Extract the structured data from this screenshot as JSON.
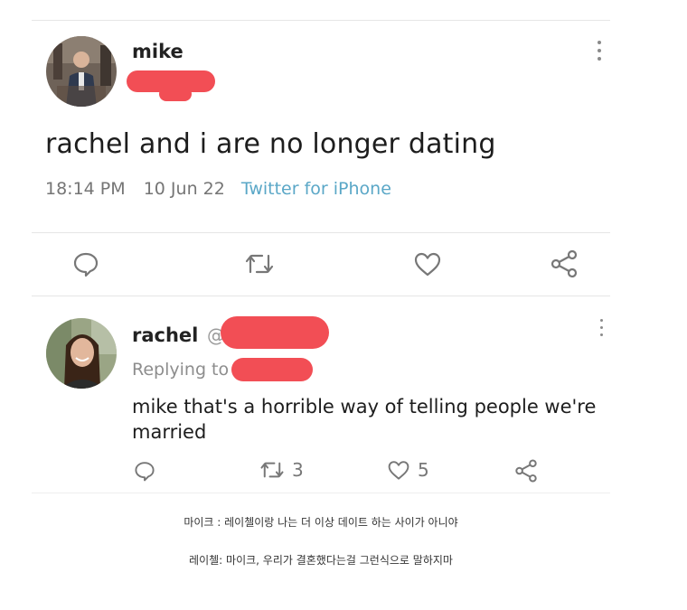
{
  "tweet": {
    "username": "mike",
    "text": "rachel and i are no longer dating",
    "time": "18:14 PM",
    "date": "10 Jun 22",
    "source": "Twitter for iPhone"
  },
  "reply": {
    "username": "rachel",
    "at": "@",
    "replying_label": "Replying to",
    "text": "mike that's a horrible way of telling people we're married",
    "retweet_count": "3",
    "like_count": "5"
  },
  "captions": {
    "line1": "마이크 : 레이첼이랑 나는 더 이상 데이트 하는 사이가 아니야",
    "line2": "레이첼: 마이크, 우리가 결혼했다는걸 그런식으로 말하지마"
  },
  "colors": {
    "redaction": "#f24e55",
    "source_link": "#5aa7c7",
    "muted": "#777777"
  },
  "icons": [
    "comment-icon",
    "retweet-icon",
    "heart-icon",
    "share-icon",
    "more-options-icon"
  ]
}
